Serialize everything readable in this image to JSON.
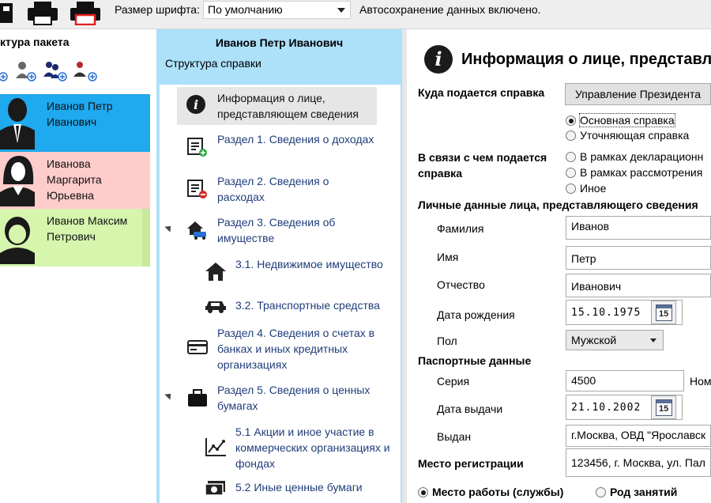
{
  "toolbar": {
    "font_size_label": "Размер шрифта:",
    "font_size_value": "По умолчанию",
    "autosave_status": "Автосохранение данных включено."
  },
  "package": {
    "title": "ктура пакета",
    "persons": [
      {
        "label": "Иванов Петр Иванович",
        "color": "#1fa9ee"
      },
      {
        "label": "Иванова Маргарита Юрьевна",
        "color": "#ffcccc"
      },
      {
        "label": "Иванов Максим Петрович",
        "color": "#d6f5ad"
      }
    ]
  },
  "tree": {
    "header": "Иванов Петр Иванович",
    "subheader": "Структура справки",
    "nodes": [
      {
        "label": "Информация о лице, представляющем сведения",
        "icon": "info-icon"
      },
      {
        "label": "Раздел 1. Сведения о доходах",
        "icon": "income-icon"
      },
      {
        "label": "Раздел 2. Сведения о расходах",
        "icon": "expense-icon"
      },
      {
        "label": "Раздел 3. Сведения об имуществе",
        "icon": "property-icon"
      },
      {
        "label": "3.1. Недвижимое имущество",
        "icon": "house-icon"
      },
      {
        "label": "3.2. Транспортные средства",
        "icon": "car-icon"
      },
      {
        "label": "Раздел 4. Сведения о счетах в банках и иных кредитных организациях",
        "icon": "card-icon"
      },
      {
        "label": "Раздел 5. Сведения о ценных бумагах",
        "icon": "briefcase-icon"
      },
      {
        "label": "5.1 Акции и иное участие в коммерческих организациях и фондах",
        "icon": "chart-icon"
      },
      {
        "label": "5.2 Иные ценные бумаги",
        "icon": "securities-icon"
      }
    ]
  },
  "form": {
    "title": "Информация о лице, представля",
    "where_label": "Куда подается справка",
    "where_value": "Управление Президента",
    "type_options": [
      "Основная справка",
      "Уточняющая справка"
    ],
    "reason_label": "В связи с чем подается справка",
    "reason_options": [
      "В рамках декларационн",
      "В рамках рассмотрения",
      "Иное"
    ],
    "personal_label": "Личные данные лица, представляющего сведения",
    "surname_label": "Фамилия",
    "surname_value": "Иванов",
    "name_label": "Имя",
    "name_value": "Петр",
    "patronymic_label": "Отчество",
    "patronymic_value": "Иванович",
    "birthdate_label": "Дата рождения",
    "birthdate_value": "15.10.1975",
    "gender_label": "Пол",
    "gender_value": "Мужской",
    "passport_label": "Паспортные данные",
    "series_label": "Серия",
    "series_value": "4500",
    "number_label": "Ном",
    "issue_date_label": "Дата выдачи",
    "issue_date_value": "21.10.2002",
    "issued_by_label": "Выдан",
    "issued_by_value": "г.Москва, ОВД \"Ярославск",
    "registration_label": "Место регистрации",
    "registration_value": "123456, г. Москва, ул. Пал",
    "work_options": [
      "Место работы (службы)",
      "Род занятий"
    ],
    "calendar_day": "15"
  }
}
